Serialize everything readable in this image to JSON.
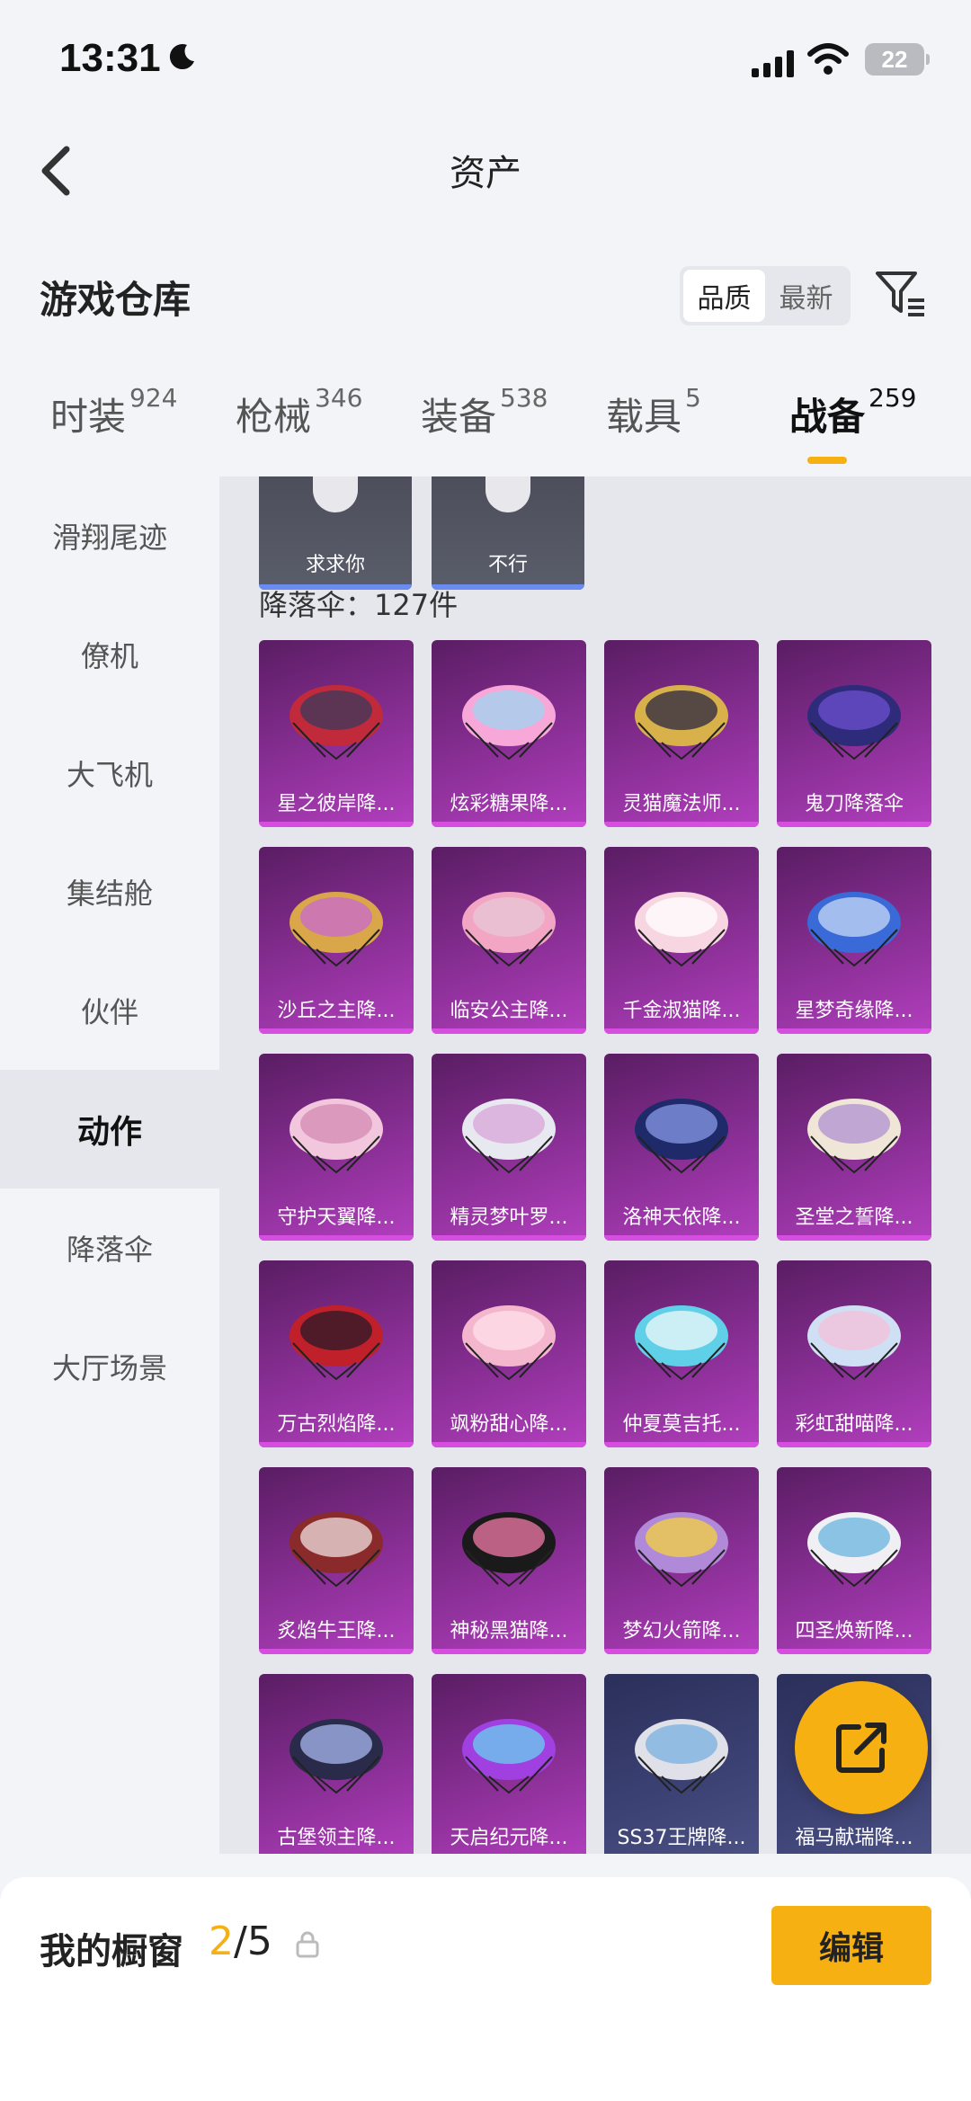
{
  "status_bar": {
    "time": "13:31",
    "battery": "22"
  },
  "header": {
    "title": "资产"
  },
  "warehouse": {
    "title": "游戏仓库",
    "sort_options": [
      "品质",
      "最新"
    ],
    "active_sort": "品质"
  },
  "tabs": [
    {
      "label": "时装",
      "count": "924"
    },
    {
      "label": "枪械",
      "count": "346"
    },
    {
      "label": "装备",
      "count": "538"
    },
    {
      "label": "载具",
      "count": "5"
    },
    {
      "label": "战备",
      "count": "259",
      "active": true
    }
  ],
  "sidebar": {
    "items": [
      "滑翔尾迹",
      "僚机",
      "大飞机",
      "集结舱",
      "伙伴",
      "动作",
      "降落伞",
      "大厅场景"
    ],
    "active": "动作"
  },
  "action_items": [
    "求求你",
    "不行"
  ],
  "parachute_section": {
    "label": "降落伞：127件"
  },
  "parachutes": [
    "星之彼岸降...",
    "炫彩糖果降...",
    "灵猫魔法师...",
    "鬼刀降落伞",
    "沙丘之主降...",
    "临安公主降...",
    "千金淑猫降...",
    "星梦奇缘降...",
    "守护天翼降...",
    "精灵梦叶罗...",
    "洛神天依降...",
    "圣堂之誓降...",
    "万古烈焰降...",
    "飒粉甜心降...",
    "仲夏莫吉托...",
    "彩虹甜喵降...",
    "炙焰牛王降...",
    "神秘黑猫降...",
    "梦幻火箭降...",
    "四圣焕新降...",
    "古堡领主降...",
    "天启纪元降...",
    "SS37王牌降...",
    "福马献瑞降..."
  ],
  "showcase": {
    "title": "我的橱窗",
    "current": "2",
    "total": "/5",
    "edit_label": "编辑"
  },
  "colors": {
    "accent": "#f6b012",
    "card_purple": "#8a2f96"
  }
}
